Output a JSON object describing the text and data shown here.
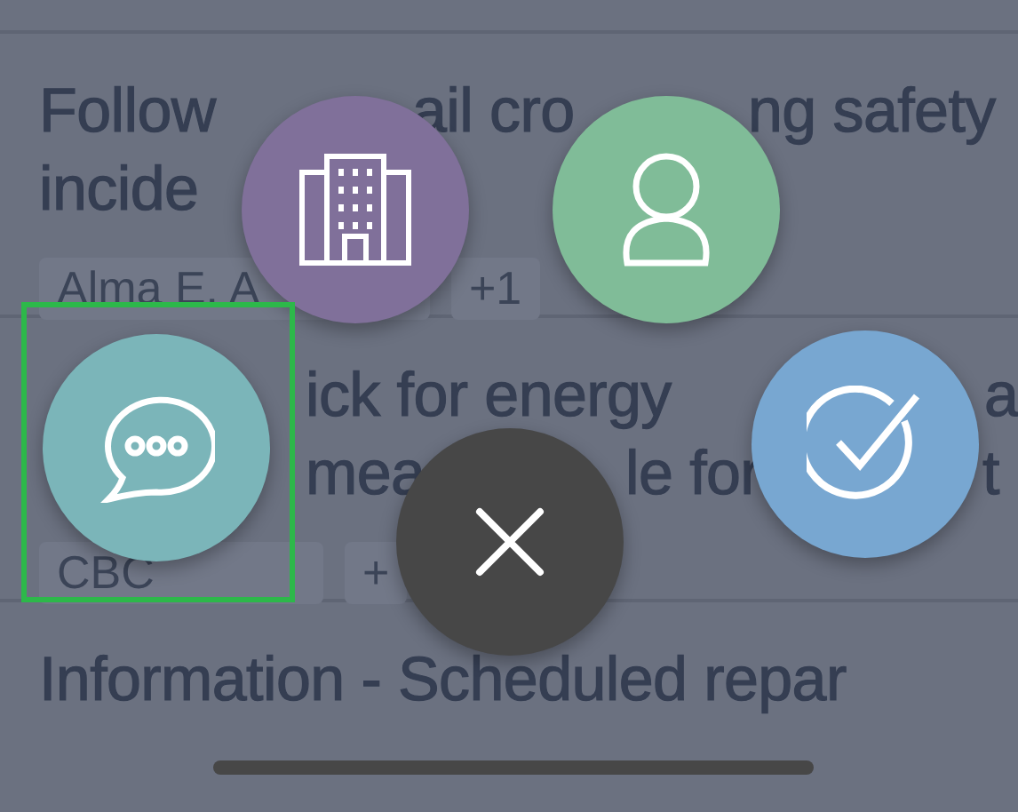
{
  "cards": [
    {
      "title_lines": [
        [
          "Follow",
          "ail cro",
          "ng safety"
        ],
        [
          "incide"
        ]
      ],
      "chips": [
        "Alma E. A",
        "+1"
      ]
    },
    {
      "title_lines": [
        [
          "ick for energy",
          "a"
        ],
        [
          "mea",
          "le for",
          "t"
        ]
      ],
      "chips": [
        "CBC",
        "+"
      ]
    },
    {
      "title_lines": [
        [
          "Information - Scheduled repar"
        ]
      ]
    }
  ],
  "actions": [
    {
      "kind": "building",
      "color": "#80709a"
    },
    {
      "kind": "person",
      "color": "#80bc98"
    },
    {
      "kind": "chat",
      "color": "#7bb5b9",
      "highlighted": true
    },
    {
      "kind": "check",
      "color": "#78a7d1"
    },
    {
      "kind": "close",
      "color": "#474747"
    }
  ]
}
